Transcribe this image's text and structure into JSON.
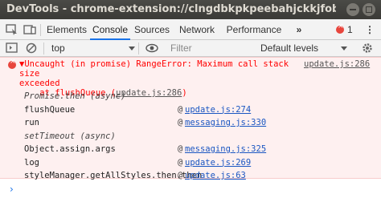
{
  "window": {
    "title": "DevTools - chrome-extension://clngdbkpkpeebahjckkjfobafhncgmne..."
  },
  "tabs": [
    {
      "label": "Elements"
    },
    {
      "label": "Console"
    },
    {
      "label": "Sources"
    },
    {
      "label": "Network"
    },
    {
      "label": "Performance"
    }
  ],
  "tabbar": {
    "more": "»",
    "error_count": "1",
    "menu": "⋮"
  },
  "toolbar": {
    "context": "top",
    "filter_placeholder": "Filter",
    "levels": "Default levels"
  },
  "error": {
    "message": "▼Uncaught (in promise) RangeError: Maximum call stack size\nexceeded",
    "at_prefix": "    at flushQueue (",
    "at_link": "update.js:286",
    "at_suffix": ")",
    "source_link": "update.js:286",
    "stack": [
      {
        "fn": "Promise.then (async)",
        "async": true,
        "link": ""
      },
      {
        "fn": "flushQueue",
        "async": false,
        "link": "update.js:274"
      },
      {
        "fn": "run",
        "async": false,
        "link": "messaging.js:330"
      },
      {
        "fn": "setTimeout (async)",
        "async": true,
        "link": ""
      },
      {
        "fn": "Object.assign.args",
        "async": false,
        "link": "messaging.js:325"
      },
      {
        "fn": "log",
        "async": false,
        "link": "update.js:269"
      },
      {
        "fn": "styleManager.getAllStyles.then.then",
        "async": false,
        "link": "update.js:63"
      }
    ],
    "at_sign": "@"
  },
  "prompt": {
    "symbol": "›"
  },
  "colors": {
    "error_red": "#ff0000",
    "error_bg": "#fef0f0",
    "accent": "#1a73e8"
  }
}
